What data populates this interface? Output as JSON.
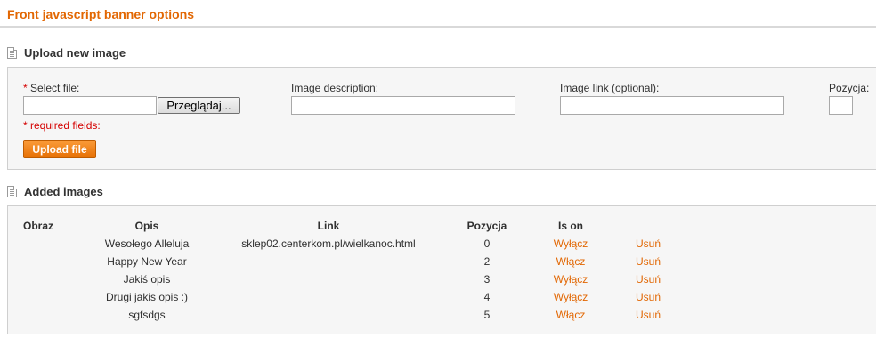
{
  "page": {
    "title": "Front javascript banner options"
  },
  "upload_section": {
    "heading": "Upload new image",
    "select_file_star": "*",
    "select_file_label": "Select file:",
    "file_value": "",
    "browse_label": "Przeglądaj...",
    "description_label": "Image description:",
    "description_value": "",
    "link_label": "Image link (optional):",
    "link_value": "",
    "position_label": "Pozycja:",
    "position_value": "",
    "required_note": "* required fields:",
    "upload_label": "Upload file"
  },
  "images_section": {
    "heading": "Added images",
    "columns": [
      "Obraz",
      "Opis",
      "Link",
      "Pozycja",
      "Is on"
    ],
    "rows": [
      {
        "opis": "Wesołego Alleluja",
        "link": "sklep02.centerkom.pl/wielkanoc.html",
        "pozycja": "0",
        "toggle": "Wyłącz",
        "delete": "Usuń"
      },
      {
        "opis": "Happy New Year",
        "link": "",
        "pozycja": "2",
        "toggle": "Włącz",
        "delete": "Usuń"
      },
      {
        "opis": "Jakiś opis",
        "link": "",
        "pozycja": "3",
        "toggle": "Wyłącz",
        "delete": "Usuń"
      },
      {
        "opis": "Drugi jakis opis :)",
        "link": "",
        "pozycja": "4",
        "toggle": "Wyłącz",
        "delete": "Usuń"
      },
      {
        "opis": "sgfsdgs",
        "link": "",
        "pozycja": "5",
        "toggle": "Włącz",
        "delete": "Usuń"
      }
    ]
  },
  "colors": {
    "accent": "#e26703",
    "required": "#d40000",
    "panel_bg": "#f6f6f6"
  },
  "icons": {
    "section_heading": "document-icon"
  }
}
